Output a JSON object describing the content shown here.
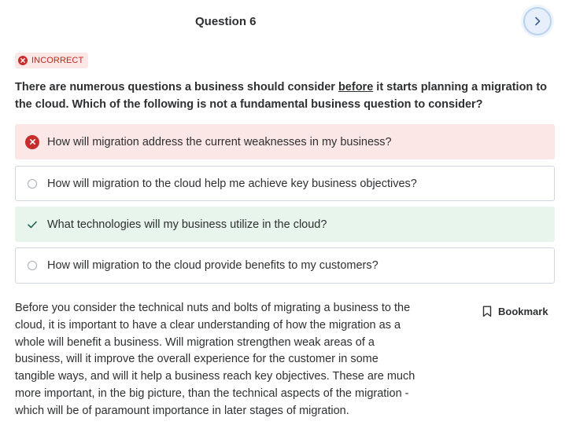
{
  "header": {
    "title": "Question 6",
    "next_icon": "chevron-right-icon"
  },
  "status": {
    "label": "INCORRECT",
    "icon": "x-circle-icon",
    "color": "#c62e2e"
  },
  "question": {
    "part1": "There are numerous questions a business should consider ",
    "emphasis": "before",
    "part2": " it starts planning a migration to the cloud. Which of the following is not a fundamental business question to consider?"
  },
  "options": [
    {
      "text": "How will migration address the current weaknesses in my business?",
      "state": "selected-incorrect"
    },
    {
      "text": "How will migration to the cloud help me achieve key business objectives?",
      "state": "unselected"
    },
    {
      "text": "What technologies will my business utilize in the cloud?",
      "state": "correct"
    },
    {
      "text": "How will migration to the cloud provide benefits to my customers?",
      "state": "unselected"
    }
  ],
  "explanation": "Before you consider the technical nuts and bolts of migrating a business to the cloud, it is important to have a clear understanding of how the migration as a whole will benefit a business. Will migration strengthen weak areas of a business, will it improve the overall experience for the customer in some tangible ways, and will it help a business reach key objectives. These are much more important, in the big picture, than the technical aspects of the migration - which will be of paramount importance in later stages of migration.",
  "bookmark": {
    "label": "Bookmark",
    "icon": "bookmark-icon"
  },
  "colors": {
    "incorrect_bg": "#fbe7e6",
    "correct_bg": "#e8f5ec",
    "correct_check": "#1e6055",
    "accent": "#5624d0"
  }
}
